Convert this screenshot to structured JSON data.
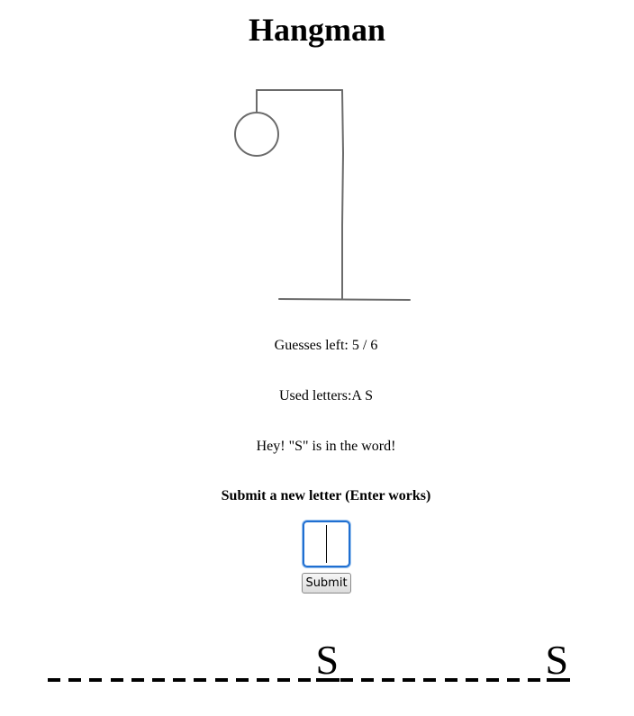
{
  "title": "Hangman",
  "status": {
    "guesses_left": "Guesses left: 5 / 6",
    "used_letters": "Used letters:A S",
    "message": "Hey! \"S\" is in the word!"
  },
  "form": {
    "prompt": "Submit a new letter (Enter works)",
    "input_value": "",
    "submit_label": "Submit"
  },
  "game": {
    "wrong_guesses": 1,
    "max_guesses": 6,
    "word_slots": [
      "",
      "",
      "",
      "",
      "",
      "",
      "",
      "",
      "",
      "",
      "",
      "",
      "",
      "S",
      "",
      "",
      "",
      "",
      "",
      "",
      "",
      "",
      "",
      "",
      "S"
    ]
  }
}
